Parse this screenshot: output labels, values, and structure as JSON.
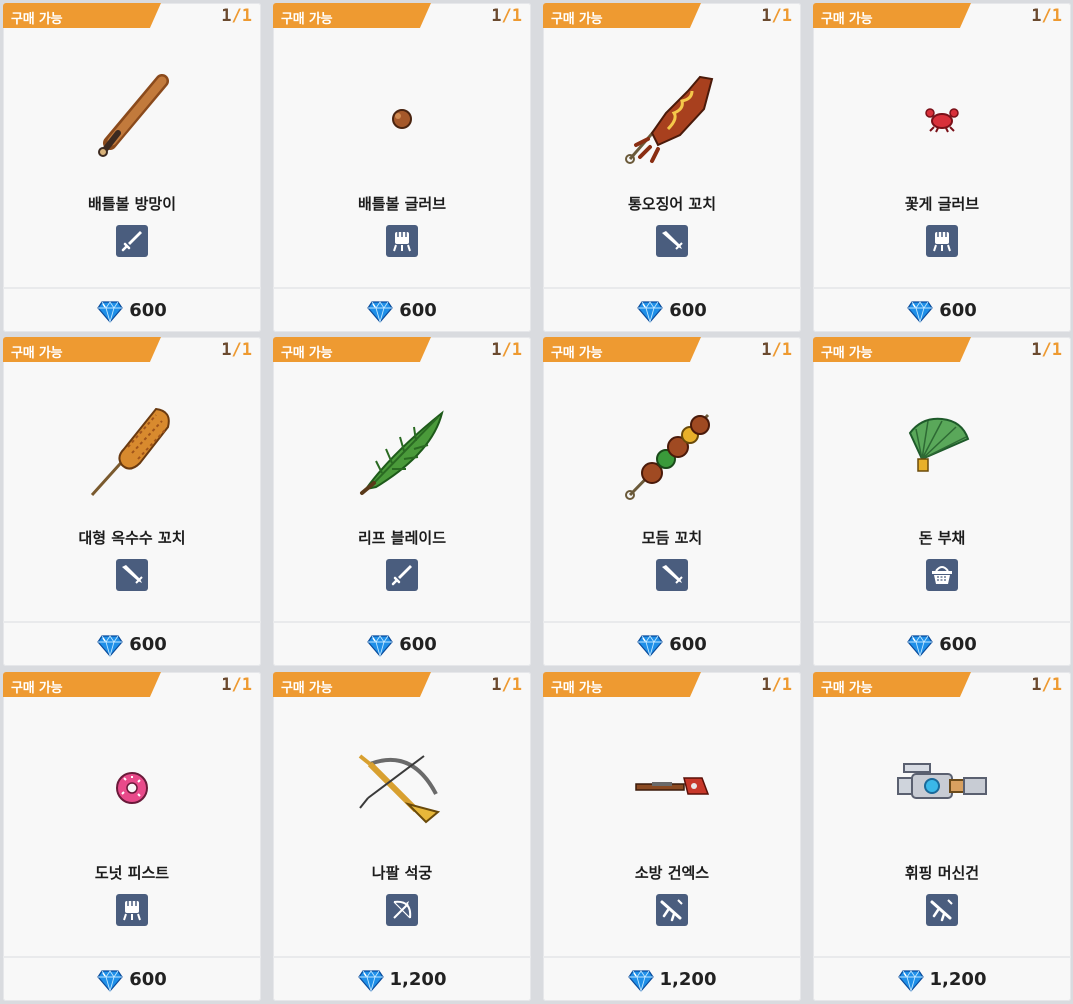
{
  "shop": {
    "items": [
      {
        "status": "구매 가능",
        "count": "1",
        "total": "1",
        "name": "배틀볼 방망이",
        "item_icon": "baseball-bat-icon",
        "type_icon": "sword-icon",
        "currency_icon": "gem-icon",
        "price": "600"
      },
      {
        "status": "구매 가능",
        "count": "1",
        "total": "1",
        "name": "배틀볼 글러브",
        "item_icon": "baseball-glove-icon",
        "type_icon": "fist-icon",
        "currency_icon": "gem-icon",
        "price": "600"
      },
      {
        "status": "구매 가능",
        "count": "1",
        "total": "1",
        "name": "통오징어 꼬치",
        "item_icon": "squid-skewer-icon",
        "type_icon": "blade-icon",
        "currency_icon": "gem-icon",
        "price": "600"
      },
      {
        "status": "구매 가능",
        "count": "1",
        "total": "1",
        "name": "꽃게 글러브",
        "item_icon": "crab-glove-icon",
        "type_icon": "fist-icon",
        "currency_icon": "gem-icon",
        "price": "600"
      },
      {
        "status": "구매 가능",
        "count": "1",
        "total": "1",
        "name": "대형 옥수수 꼬치",
        "item_icon": "corn-skewer-icon",
        "type_icon": "blade-icon",
        "currency_icon": "gem-icon",
        "price": "600"
      },
      {
        "status": "구매 가능",
        "count": "1",
        "total": "1",
        "name": "리프 블레이드",
        "item_icon": "leaf-blade-icon",
        "type_icon": "sword-icon",
        "currency_icon": "gem-icon",
        "price": "600"
      },
      {
        "status": "구매 가능",
        "count": "1",
        "total": "1",
        "name": "모듬 꼬치",
        "item_icon": "mixed-skewer-icon",
        "type_icon": "blade-icon",
        "currency_icon": "gem-icon",
        "price": "600"
      },
      {
        "status": "구매 가능",
        "count": "1",
        "total": "1",
        "name": "돈 부채",
        "item_icon": "money-fan-icon",
        "type_icon": "basket-icon",
        "currency_icon": "gem-icon",
        "price": "600"
      },
      {
        "status": "구매 가능",
        "count": "1",
        "total": "1",
        "name": "도넛 피스트",
        "item_icon": "donut-icon",
        "type_icon": "fist-icon",
        "currency_icon": "gem-icon",
        "price": "600"
      },
      {
        "status": "구매 가능",
        "count": "1",
        "total": "1",
        "name": "나팔 석궁",
        "item_icon": "trumpet-crossbow-icon",
        "type_icon": "bow-icon",
        "currency_icon": "gem-icon",
        "price": "1,200"
      },
      {
        "status": "구매 가능",
        "count": "1",
        "total": "1",
        "name": "소방 건엑스",
        "item_icon": "fire-gun-axe-icon",
        "type_icon": "rifle-icon",
        "currency_icon": "gem-icon",
        "price": "1,200"
      },
      {
        "status": "구매 가능",
        "count": "1",
        "total": "1",
        "name": "휘핑 머신건",
        "item_icon": "whipping-machine-gun-icon",
        "type_icon": "rifle-icon",
        "currency_icon": "gem-icon",
        "price": "1,200"
      }
    ]
  },
  "colors": {
    "background": "#d9dbdf",
    "card": "#f8f8f8",
    "badge": "#ee9a31",
    "type_icon_bg": "#4a5d7e",
    "gem": "#1e8fe8"
  }
}
